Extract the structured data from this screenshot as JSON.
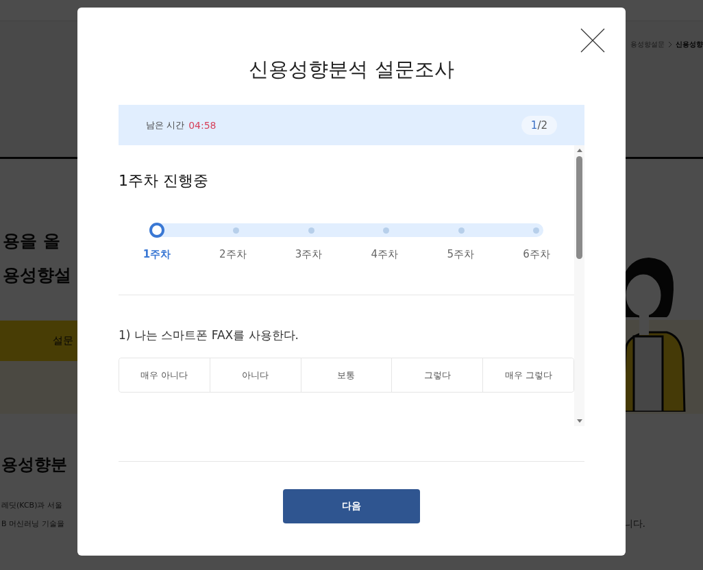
{
  "background": {
    "breadcrumb": [
      "용성향설문",
      "신용성향"
    ],
    "headline": [
      "용을 올",
      "용성향설"
    ],
    "survey_button": "설문",
    "section_title": "용성향분",
    "paragraph": [
      "레딧(KCB)과 서울",
      "B 머신러닝 기술을"
    ],
    "paragraph_end": "니다."
  },
  "modal": {
    "title": "신용성향분석 설문조사",
    "timer": {
      "label": "남은 시간",
      "value": "04:58"
    },
    "page": {
      "current": "1",
      "rest": "/2"
    },
    "status": "1주차 진행중",
    "weeks": [
      {
        "label": "1주차",
        "selected": true
      },
      {
        "label": "2주차",
        "selected": false
      },
      {
        "label": "3주차",
        "selected": false
      },
      {
        "label": "4주차",
        "selected": false
      },
      {
        "label": "5주차",
        "selected": false
      },
      {
        "label": "6주차",
        "selected": false
      }
    ],
    "question": "1) 나는 스마트폰 FAX를 사용한다.",
    "options": [
      {
        "label": "매우 아니다",
        "selected": false
      },
      {
        "label": "아니다",
        "selected": false
      },
      {
        "label": "보통",
        "selected": false
      },
      {
        "label": "그렇다",
        "selected": false
      },
      {
        "label": "매우 그렇다",
        "selected": false
      }
    ],
    "next_button": "다음"
  }
}
